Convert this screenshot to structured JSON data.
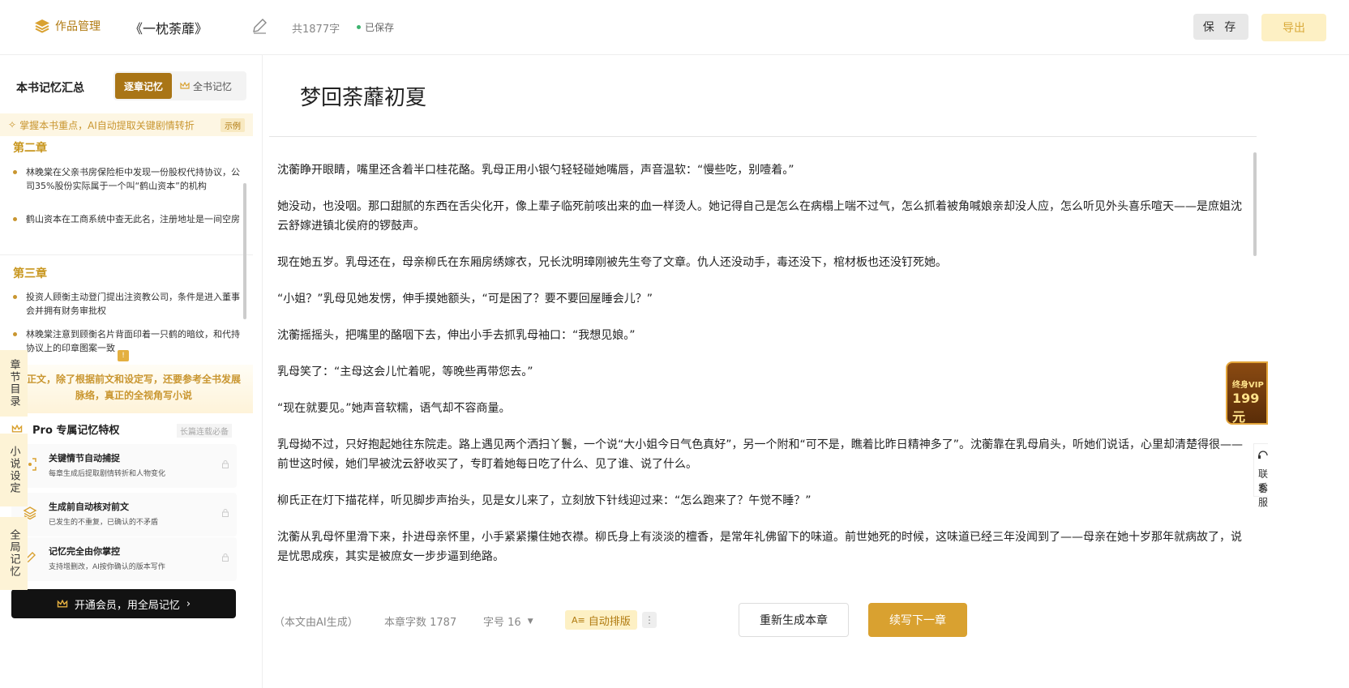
{
  "header": {
    "logo_label": "作品管理",
    "book_title": "《一枕荼蘼》",
    "word_count": "共1877字",
    "saved_status": "已保存",
    "save_label": "保 存",
    "export_label": "导出"
  },
  "sidebar": {
    "title": "本书记忆汇总",
    "tab_active": "逐章记忆",
    "tab_other": "全书记忆",
    "tip": "掌握本书重点，AI自动提取关键剧情转折",
    "tip_tag": "示例",
    "chapters": [
      {
        "title": "第二章",
        "items": [
          "林晚棠在父亲书房保险柜中发现一份股权代持协议，公司35%股份实际属于一个叫“鹤山资本”的机构",
          "鹤山资本在工商系统中查无此名，注册地址是一间空房"
        ]
      },
      {
        "title": "第三章",
        "items": [
          "投资人顾衡主动登门提出注资教公司，条件是进入董事会并拥有财务审批权",
          "林晚棠注意到顾衡名片背面印着一只鹤的暗纹，和代持协议上的印章图案一致"
        ]
      }
    ],
    "promo_badge": "!",
    "promo_text": "正文，除了根据前文和设定写，还要参考全书发展脉络，真正的全视角写小说",
    "pro_title": "Pro 专属记忆特权",
    "pro_tag": "长篇连载必备",
    "features": [
      {
        "title": "关键情节自动捕捉",
        "desc": "每章生成后提取剧情转折和人物变化"
      },
      {
        "title": "生成前自动核对前文",
        "desc": "已发生的不重复，已确认的不矛盾"
      },
      {
        "title": "记忆完全由你掌控",
        "desc": "支持增删改，AI按你确认的版本写作"
      }
    ],
    "member_button": "开通会员，用全局记忆"
  },
  "vertical_tabs": [
    "章节目录",
    "小说设定",
    "全局记忆"
  ],
  "editor": {
    "chapter_title": "梦回荼蘼初夏",
    "paragraphs": [
      "沈蘅睁开眼睛，嘴里还含着半口桂花酪。乳母正用小银勺轻轻碰她嘴唇，声音温软：“慢些吃，别噎着。”",
      "她没动，也没咽。那口甜腻的东西在舌尖化开，像上辈子临死前咳出来的血一样烫人。她记得自己是怎么在病榻上喘不过气，怎么抓着被角喊娘亲却没人应，怎么听见外头喜乐喧天——是庶姐沈云舒嫁进镇北侯府的锣鼓声。",
      "现在她五岁。乳母还在，母亲柳氏在东厢房绣嫁衣，兄长沈明璋刚被先生夸了文章。仇人还没动手，毒还没下，棺材板也还没钉死她。",
      "“小姐？”乳母见她发愣，伸手摸她额头，“可是困了？要不要回屋睡会儿？”",
      "沈蘅摇摇头，把嘴里的酪咽下去，伸出小手去抓乳母袖口：“我想见娘。”",
      "乳母笑了：“主母这会儿忙着呢，等晚些再带您去。”",
      "“现在就要见。”她声音软糯，语气却不容商量。",
      "乳母拗不过，只好抱起她往东院走。路上遇见两个洒扫丫鬟，一个说“大小姐今日气色真好”，另一个附和“可不是，瞧着比昨日精神多了”。沈蘅靠在乳母肩头，听她们说话，心里却清楚得很——前世这时候，她们早被沈云舒收买了，专盯着她每日吃了什么、见了谁、说了什么。",
      "柳氏正在灯下描花样，听见脚步声抬头，见是女儿来了，立刻放下针线迎过来：“怎么跑来了？午觉不睡？”",
      "沈蘅从乳母怀里滑下来，扑进母亲怀里，小手紧紧攥住她衣襟。柳氏身上有淡淡的檀香，是常年礼佛留下的味道。前世她死的时候，这味道已经三年没闻到了——母亲在她十岁那年就病故了，说是忧思成疾，其实是被庶女一步步逼到绝路。"
    ]
  },
  "bottom_bar": {
    "ai_note": "（本文由AI生成）",
    "chapter_word_count": "本章字数 1787",
    "font_size": "字号 16",
    "auto_layout": "自动排版",
    "more": "⋮",
    "regenerate": "重新生成本章",
    "continue": "续写下一章"
  },
  "right_float": {
    "vip_line1": "终身VIP",
    "vip_line2": "199元",
    "cs_line1": "联系",
    "cs_line2": "客服"
  }
}
